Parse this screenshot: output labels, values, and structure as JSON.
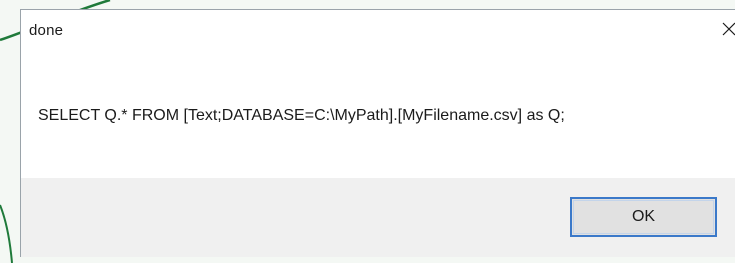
{
  "dialog": {
    "title": "done",
    "message": "SELECT Q.* FROM [Text;DATABASE=C:\\MyPath].[MyFilename.csv] as Q;",
    "ok_label": "OK",
    "close_icon": "close-icon"
  },
  "colors": {
    "accent_border": "#3b79c9",
    "background_line": "#1f7a3a",
    "button_bar": "#f0f0f0"
  }
}
